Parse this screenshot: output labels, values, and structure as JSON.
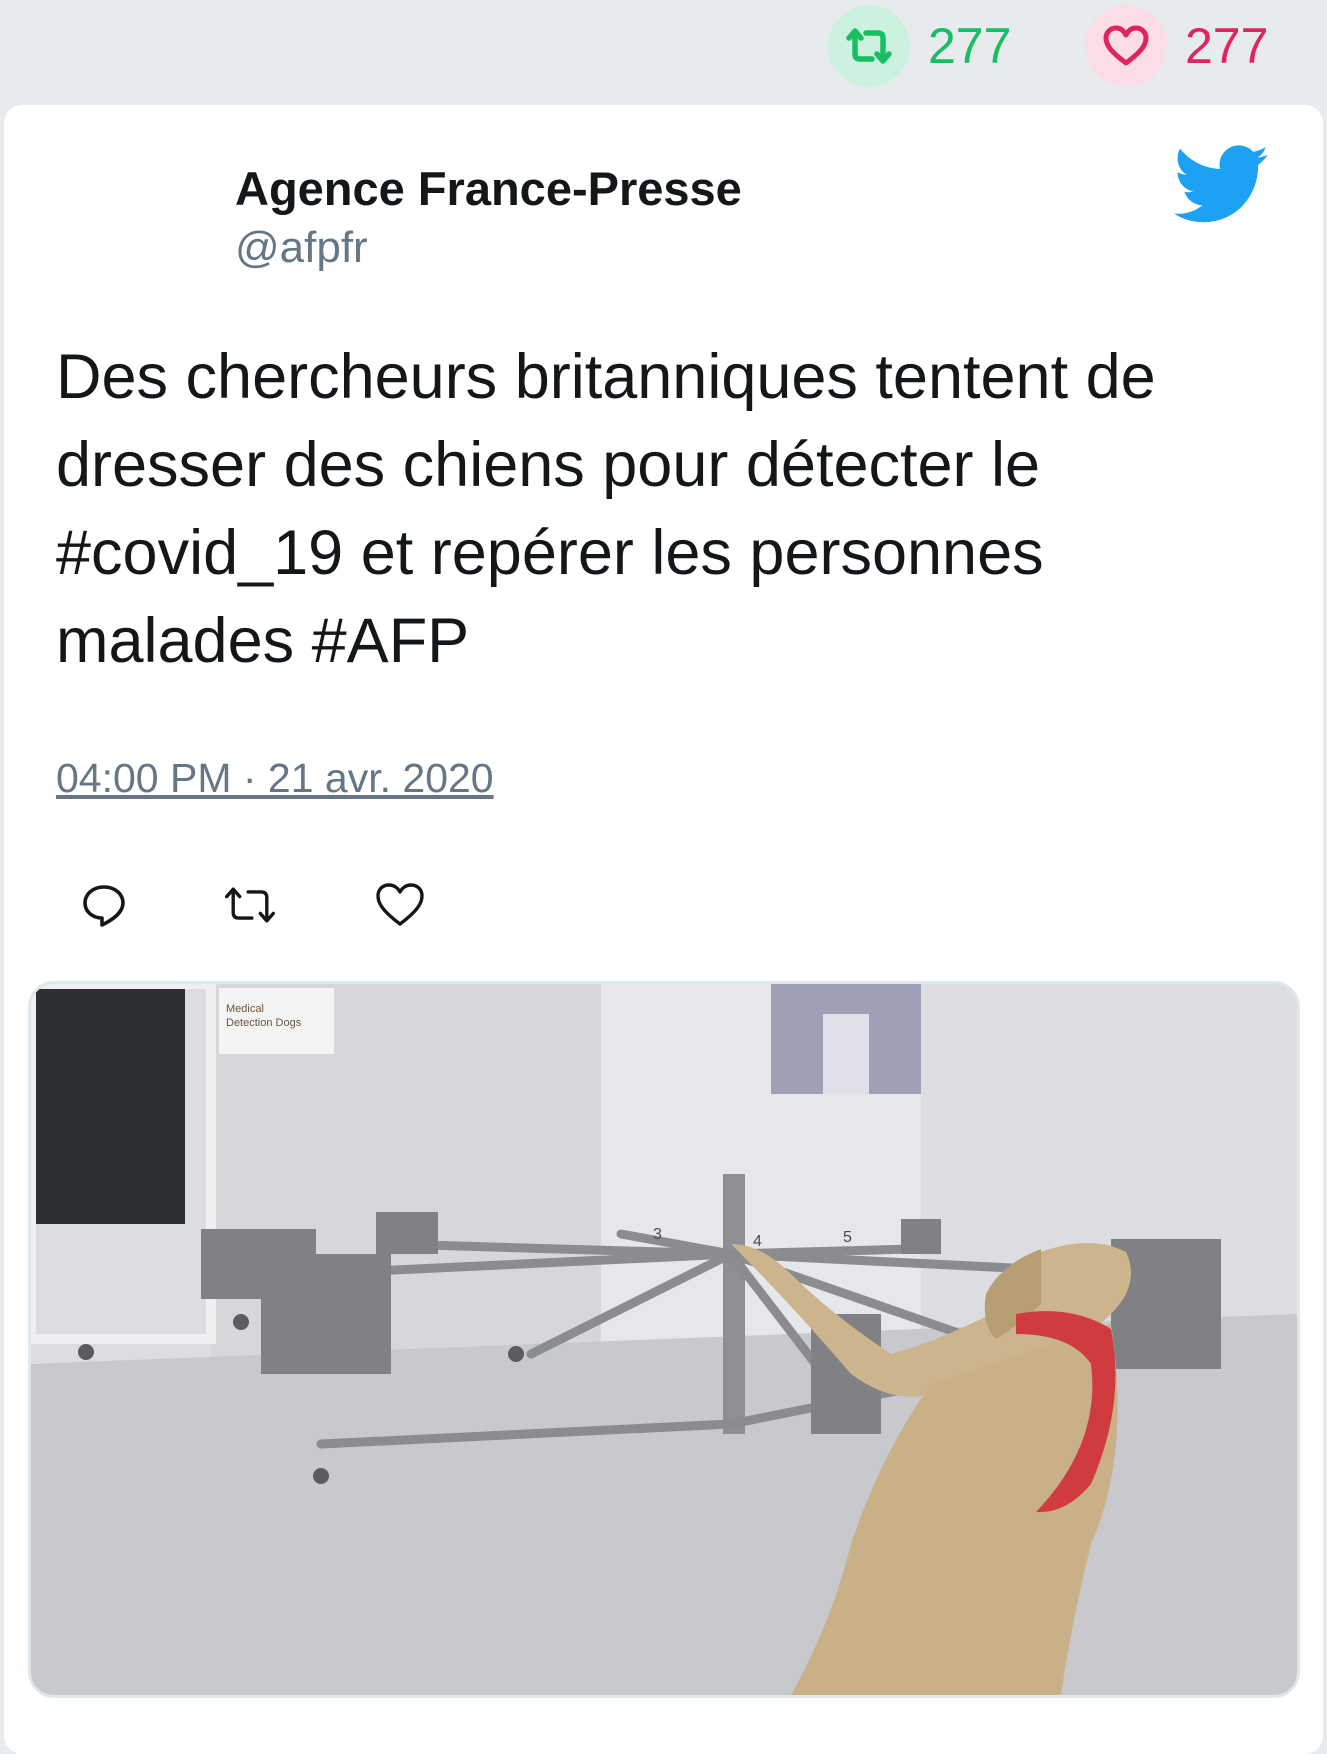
{
  "stats": {
    "retweets": "277",
    "likes": "277",
    "retweet_color": "#17bf63",
    "like_color": "#e0245e"
  },
  "tweet": {
    "author_name": "Agence France-Presse",
    "author_handle": "@afpfr",
    "text": "Des chercheurs britanniques tentent de dresser des chiens pour détecter le #covid_19 et repérer les personnes malades #AFP",
    "timestamp": "04:00 PM · 21 avr. 2020",
    "brand_icon": "twitter-bird-icon",
    "brand_color": "#1da1f2"
  },
  "actions": [
    {
      "icon": "reply-icon"
    },
    {
      "icon": "retweet-icon"
    },
    {
      "icon": "like-icon"
    }
  ],
  "media": {
    "sign_text_line1": "Medical",
    "sign_text_line2": "Detection Dogs",
    "carousel_numbers": [
      "3",
      "4",
      "5"
    ]
  }
}
